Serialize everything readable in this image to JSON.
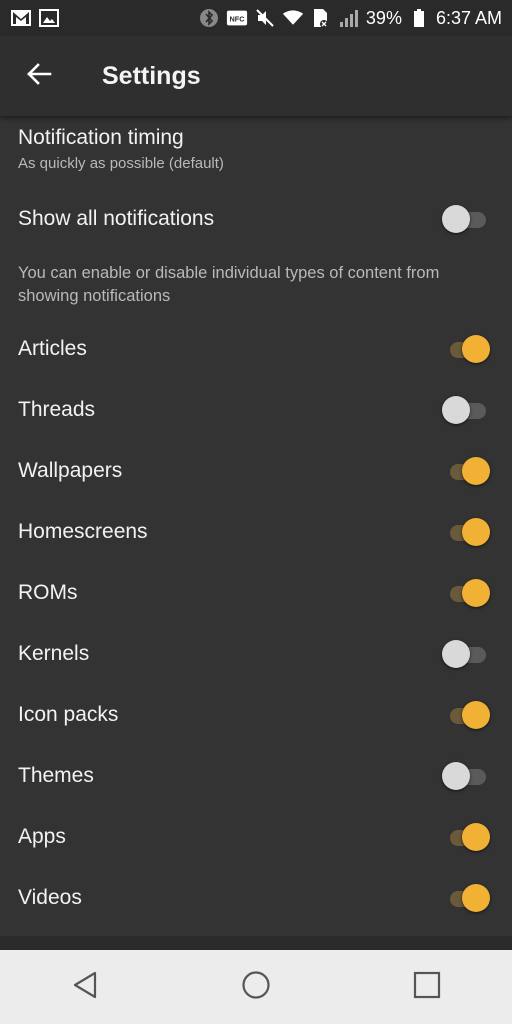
{
  "status_bar": {
    "battery_percent": "39%",
    "time": "6:37 AM",
    "icons": [
      "gmail-icon",
      "gallery-icon",
      "bluetooth-icon",
      "nfc-icon",
      "mute-icon",
      "wifi-icon",
      "sim-icon",
      "signal-icon",
      "battery-icon"
    ],
    "nfc_label": "NFC"
  },
  "appbar": {
    "title": "Settings"
  },
  "notification_timing": {
    "title": "Notification timing",
    "subtitle": "As quickly as possible (default)"
  },
  "show_all": {
    "label": "Show all notifications",
    "on": false
  },
  "hint": "You can enable or disable individual types of content from showing notifications",
  "items": [
    {
      "label": "Articles",
      "on": true
    },
    {
      "label": "Threads",
      "on": false
    },
    {
      "label": "Wallpapers",
      "on": true
    },
    {
      "label": "Homescreens",
      "on": true
    },
    {
      "label": "ROMs",
      "on": true
    },
    {
      "label": "Kernels",
      "on": false
    },
    {
      "label": "Icon packs",
      "on": true
    },
    {
      "label": "Themes",
      "on": false
    },
    {
      "label": "Apps",
      "on": true
    },
    {
      "label": "Videos",
      "on": true
    }
  ],
  "colors": {
    "accent": "#f0b135",
    "background": "#333333",
    "navbar": "#ececec"
  }
}
